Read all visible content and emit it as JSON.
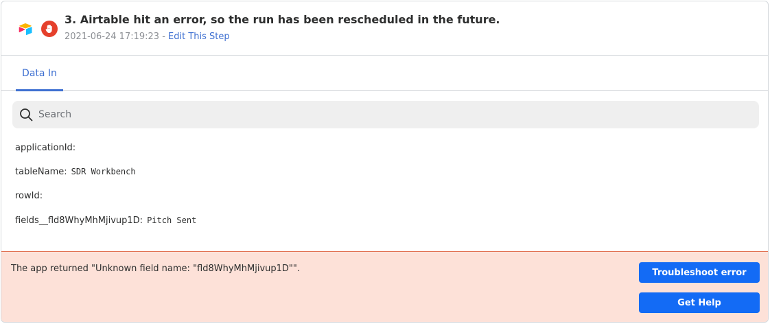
{
  "step": {
    "title": "3. Airtable hit an error, so the run has been rescheduled in the future.",
    "timestamp": "2021-06-24 17:19:23",
    "separator": " - ",
    "edit_link": "Edit This Step",
    "app_icon": "airtable-icon",
    "status_icon": "hand-stop-icon"
  },
  "tabs": [
    {
      "label": "Data In",
      "active": true
    }
  ],
  "search": {
    "placeholder": "Search",
    "value": ""
  },
  "fields": [
    {
      "key": "applicationId:",
      "value": ""
    },
    {
      "key": "tableName:",
      "value": "SDR Workbench"
    },
    {
      "key": "rowId:",
      "value": ""
    },
    {
      "key": "fields__fld8WhyMhMjivup1D:",
      "value": "Pitch Sent"
    }
  ],
  "error": {
    "message": "The app returned \"Unknown field name: \"fld8WhyMhMjivup1D\"\".",
    "troubleshoot_label": "Troubleshoot error",
    "help_label": "Get Help"
  },
  "colors": {
    "accent": "#3d6fd1",
    "button": "#136bf5",
    "error_bg": "#fde1d8",
    "error_icon": "#e5402c"
  }
}
